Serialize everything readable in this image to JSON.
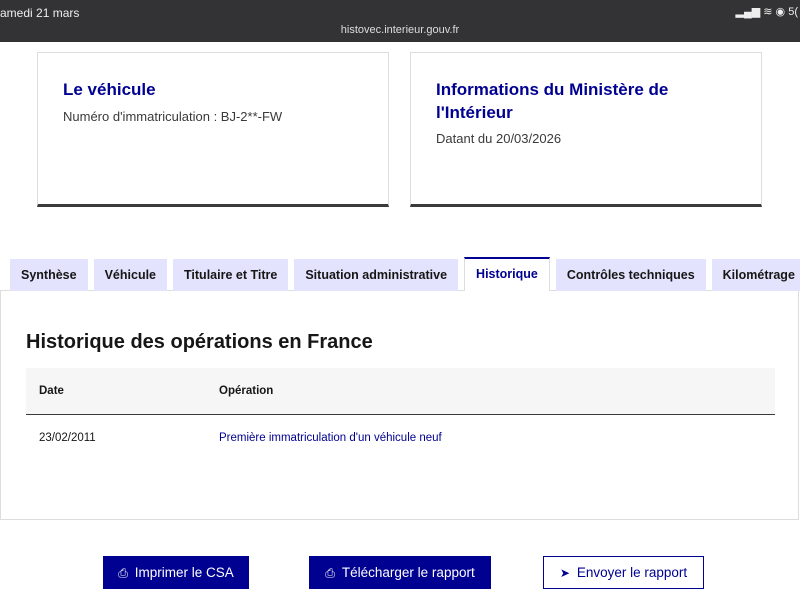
{
  "status_bar": {
    "time": "amedi 21 mars",
    "url": "histovec.interieur.gouv.fr",
    "icons": "▂▄▆ ≋ ◉ 5("
  },
  "cards": [
    {
      "title": "Le véhicule",
      "text": "Numéro d'immatriculation : BJ-2**-FW"
    },
    {
      "title": "Informations du Ministère de l'Intérieur",
      "text": "Datant du 20/03/2026"
    }
  ],
  "tabs": [
    "Synthèse",
    "Véhicule",
    "Titulaire et Titre",
    "Situation administrative",
    "Historique",
    "Contrôles techniques",
    "Kilométrage"
  ],
  "panel": {
    "title": "Historique des opérations en France",
    "columns": [
      "Date",
      "Opération"
    ],
    "rows": [
      {
        "date": "23/02/2011",
        "operation": "Première immatriculation d'un véhicule neuf"
      }
    ]
  },
  "buttons": {
    "print": "Imprimer le CSA",
    "download": "Télécharger le rapport",
    "send": "Envoyer le rapport"
  }
}
